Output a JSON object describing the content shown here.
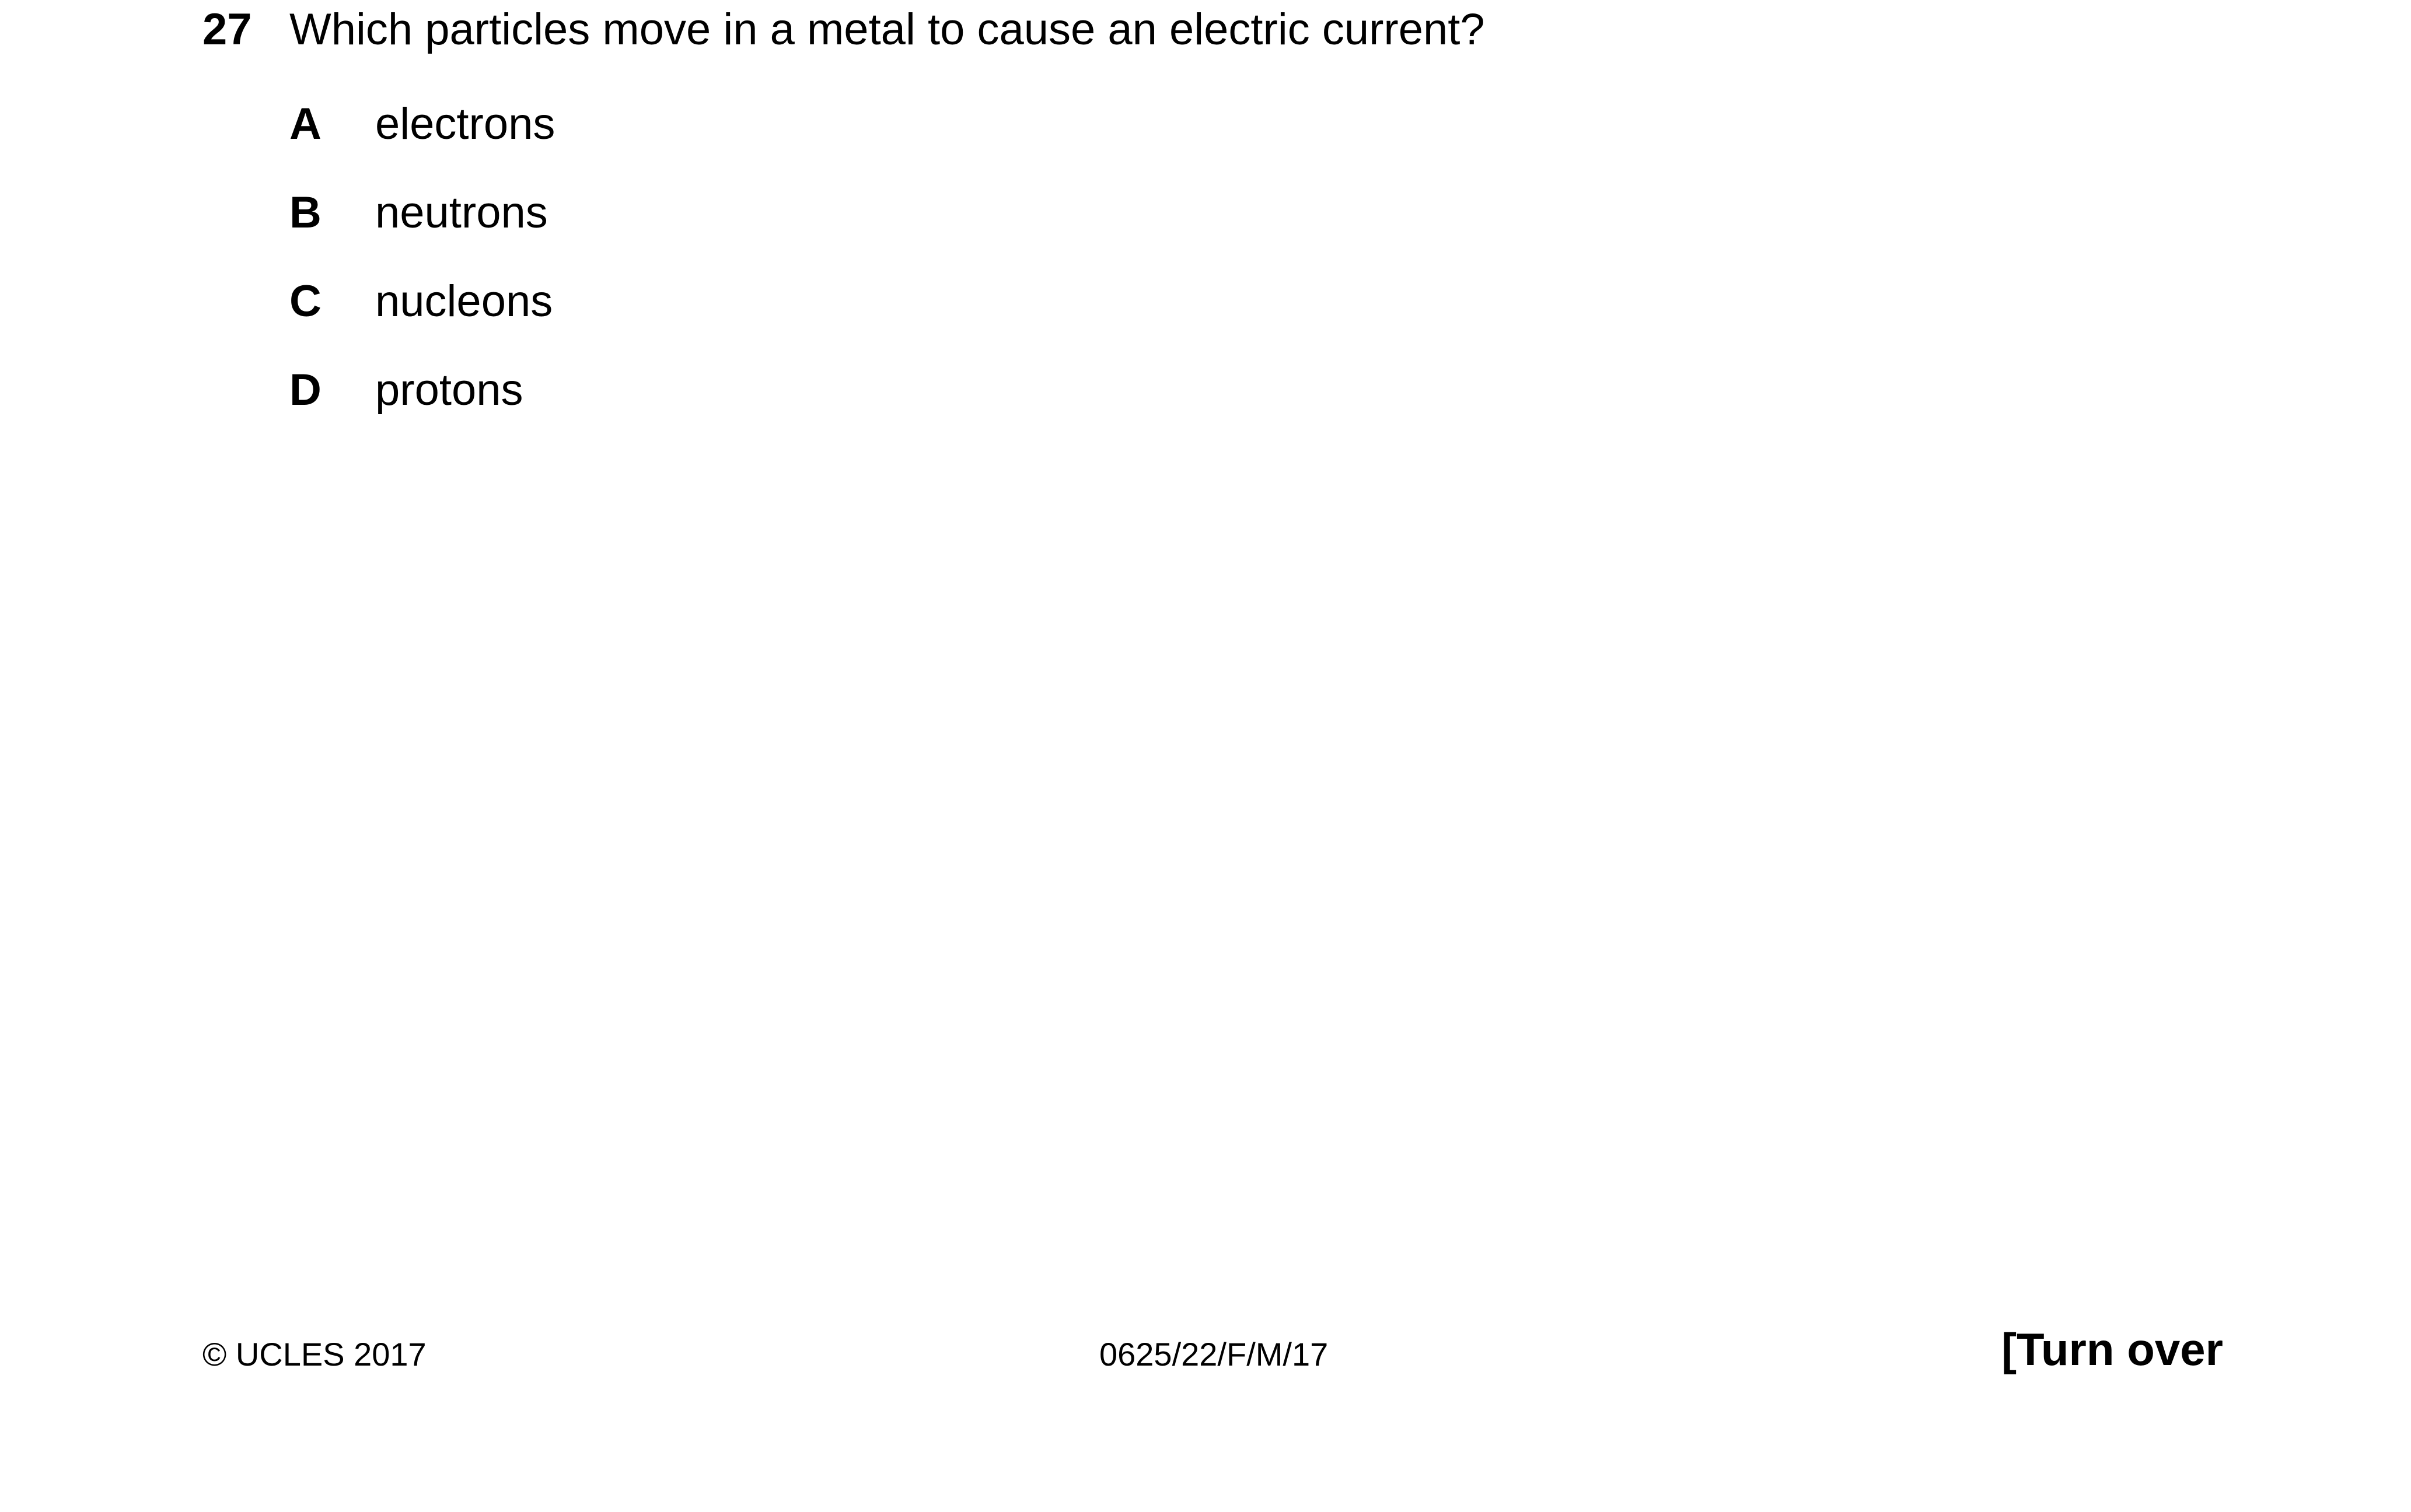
{
  "question": {
    "number": "27",
    "text": "Which particles move in a metal to cause an electric current?",
    "options": [
      {
        "letter": "A",
        "text": "electrons"
      },
      {
        "letter": "B",
        "text": "neutrons"
      },
      {
        "letter": "C",
        "text": "nucleons"
      },
      {
        "letter": "D",
        "text": "protons"
      }
    ]
  },
  "footer": {
    "copyright": "© UCLES 2017",
    "paper_code": "0625/22/F/M/17",
    "turn_over": "[Turn over"
  }
}
